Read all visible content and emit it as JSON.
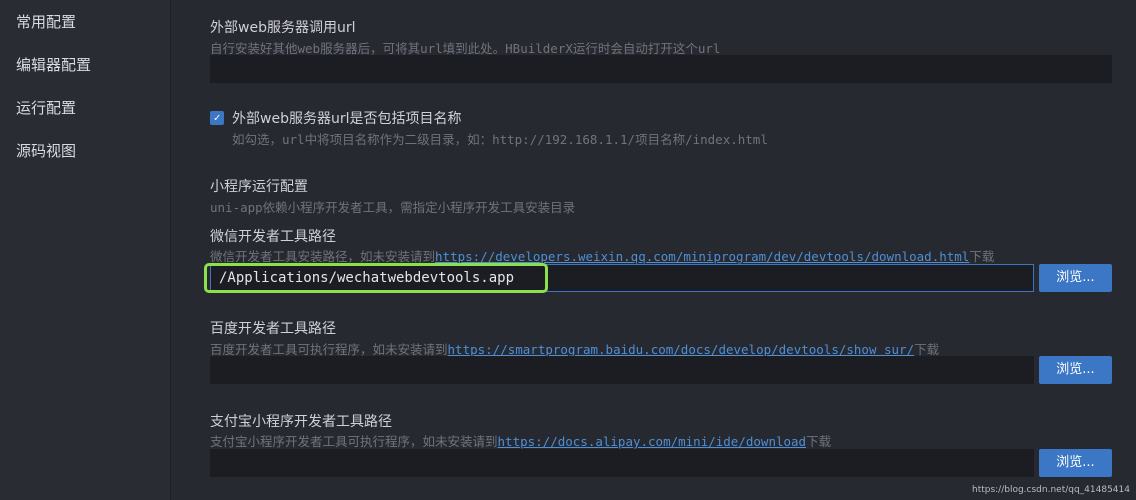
{
  "sidebar": {
    "items": [
      {
        "label": "常用配置"
      },
      {
        "label": "编辑器配置"
      },
      {
        "label": "运行配置"
      },
      {
        "label": "源码视图"
      }
    ]
  },
  "external_server": {
    "title": "外部web服务器调用url",
    "desc": "自行安装好其他web服务器后，可将其url填到此处。HBuilderX运行时会自动打开这个url",
    "value": ""
  },
  "include_project": {
    "checked": true,
    "check_glyph": "✓",
    "title": "外部web服务器url是否包括项目名称",
    "desc": "如勾选，url中将项目名称作为二级目录，如：http://192.168.1.1/项目名称/index.html"
  },
  "miniprogram": {
    "title": "小程序运行配置",
    "desc": "uni-app依赖小程序开发者工具，需指定小程序开发工具安装目录"
  },
  "wechat": {
    "title": "微信开发者工具路径",
    "desc_prefix": "微信开发者工具安装路径，如未安装请到",
    "link": "https://developers.weixin.qq.com/miniprogram/dev/devtools/download.html",
    "desc_suffix": "下载",
    "value": "/Applications/wechatwebdevtools.app",
    "browse_label": "浏览..."
  },
  "baidu": {
    "title": "百度开发者工具路径",
    "desc_prefix": "百度开发者工具可执行程序，如未安装请到",
    "link": "https://smartprogram.baidu.com/docs/develop/devtools/show_sur/",
    "desc_suffix": "下载",
    "value": "",
    "browse_label": "浏览..."
  },
  "alipay": {
    "title": "支付宝小程序开发者工具路径",
    "desc_prefix": "支付宝小程序开发者工具可执行程序，如未安装请到",
    "link": "https://docs.alipay.com/mini/ide/download",
    "desc_suffix": "下载",
    "value": "",
    "browse_label": "浏览..."
  },
  "watermark": "https://blog.csdn.net/qq_41485414",
  "colors": {
    "accent": "#3b77c4",
    "highlight": "#8ce04a",
    "link": "#4e8fd6"
  }
}
